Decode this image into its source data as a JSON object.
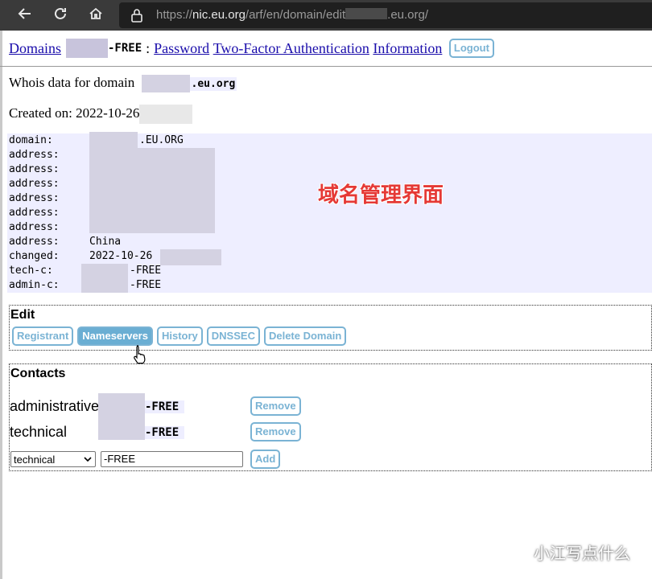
{
  "browser": {
    "back_icon": "arrow-left-icon",
    "reload_icon": "reload-icon",
    "home_icon": "home-icon",
    "url_prefix": "https://",
    "url_host": "nic.eu.org",
    "url_path": "/arf/en/domain/edit",
    "url_tail": ".eu.org/"
  },
  "menu": {
    "domains": "Domains",
    "handle_suffix": "-FREE",
    "separator": ":",
    "password": "Password",
    "two_factor": "Two-Factor Authentication",
    "information": "Information",
    "logout": "Logout"
  },
  "whois": {
    "title_prefix": "Whois data for domain",
    "domain_suffix": ".eu.org",
    "created_label": "Created on: 2022-10-26",
    "rows": [
      {
        "key": "domain:",
        "value": ".EU.ORG"
      },
      {
        "key": "address:",
        "value": ""
      },
      {
        "key": "address:",
        "value": ""
      },
      {
        "key": "address:",
        "value": ""
      },
      {
        "key": "address:",
        "value": ""
      },
      {
        "key": "address:",
        "value": ""
      },
      {
        "key": "address:",
        "value": ""
      },
      {
        "key": "address:",
        "value": "China"
      },
      {
        "key": "changed:",
        "value": "2022-10-26"
      },
      {
        "key": "tech-c:",
        "value": "-FREE"
      },
      {
        "key": "admin-c:",
        "value": "-FREE"
      }
    ]
  },
  "annotation": "域名管理界面",
  "edit": {
    "title": "Edit",
    "buttons": [
      "Registrant",
      "Nameservers",
      "History",
      "DNSSEC",
      "Delete Domain"
    ]
  },
  "contacts": {
    "title": "Contacts",
    "administrative_label": "administrative",
    "technical_label": "technical",
    "handle_suffix": "-FREE",
    "remove_label": "Remove",
    "select_value": "technical",
    "input_value": "-FREE",
    "add_label": "Add"
  },
  "watermark": {
    "text": "小江写点什么",
    "icon": "wechat-icon"
  },
  "colors": {
    "button_border": "#7ab3d4",
    "button_active_bg": "#6aaed3",
    "whois_bg": "#eeeeff",
    "annotation": "#e53935"
  }
}
